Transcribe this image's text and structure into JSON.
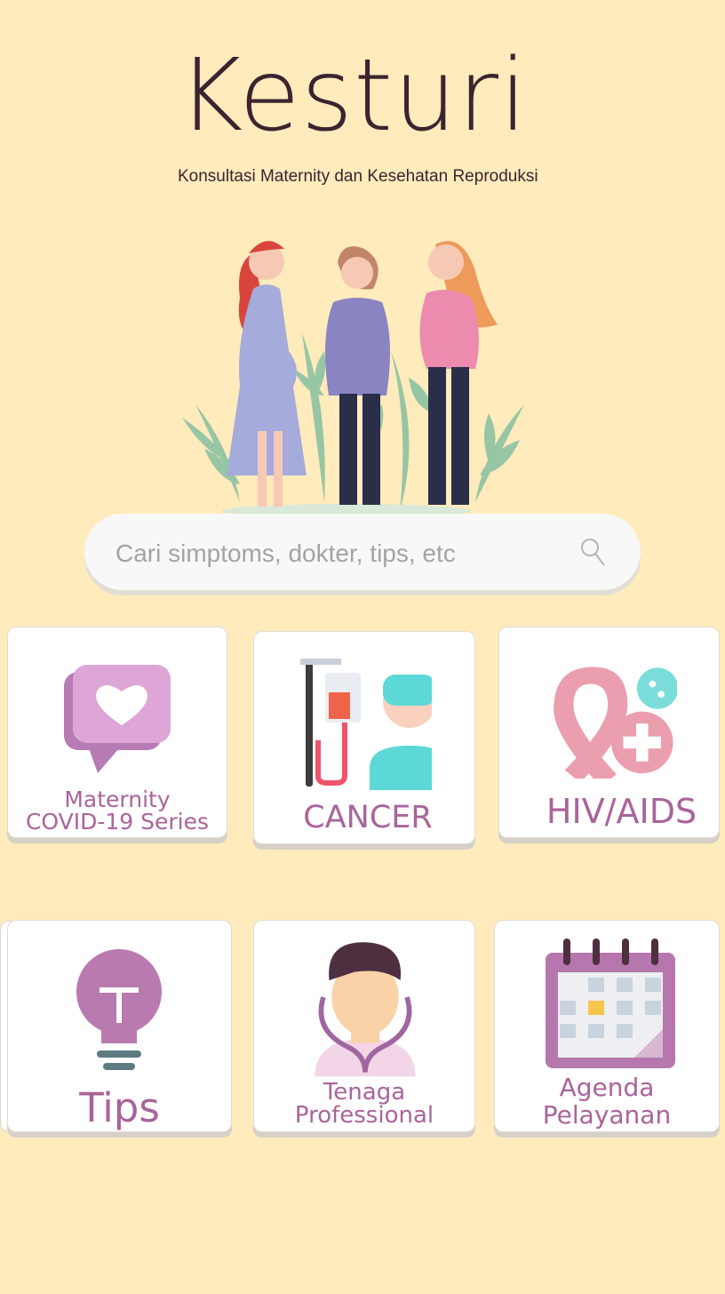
{
  "app": {
    "title": "Kesturi",
    "subtitle": "Konsultasi Maternity dan Kesehatan Reproduksi"
  },
  "search": {
    "placeholder": "Cari simptoms, dokter, tips, etc"
  },
  "menu": {
    "maternity": {
      "line1": "Maternity",
      "line2": "COVID-19 Series"
    },
    "cancer": {
      "label": "CANCER"
    },
    "hiv": {
      "label": "HIV/AIDS"
    },
    "tips": {
      "label": "Tips"
    },
    "professional": {
      "line1": "Tenaga",
      "line2": "Professional"
    },
    "agenda": {
      "line1": "Agenda",
      "line2": "Pelayanan"
    }
  },
  "icons": {
    "search": "search-icon",
    "maternity": "heart-chat-icon",
    "cancer": "iv-drip-patient-icon",
    "hiv": "awareness-ribbon-icon",
    "tips": "lightbulb-icon",
    "professional": "doctor-icon",
    "agenda": "calendar-icon"
  },
  "colors": {
    "background": "#FFEBBC",
    "title": "#3B2430",
    "accent": "#A9649A",
    "card": "#FFFFFF"
  }
}
